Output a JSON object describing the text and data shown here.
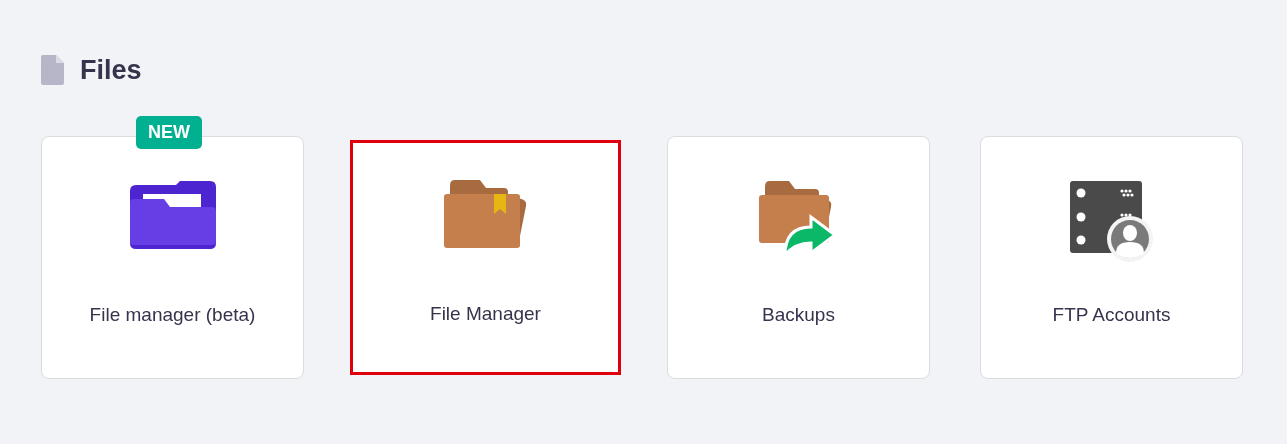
{
  "section": {
    "title": "Files"
  },
  "cards": [
    {
      "kind": "beta-folder",
      "label": "File manager (beta)",
      "badge": "NEW",
      "highlighted": false
    },
    {
      "kind": "folder",
      "label": "File Manager",
      "highlighted": true
    },
    {
      "kind": "backup",
      "label": "Backups",
      "highlighted": false
    },
    {
      "kind": "ftp",
      "label": "FTP Accounts",
      "highlighted": false
    }
  ]
}
